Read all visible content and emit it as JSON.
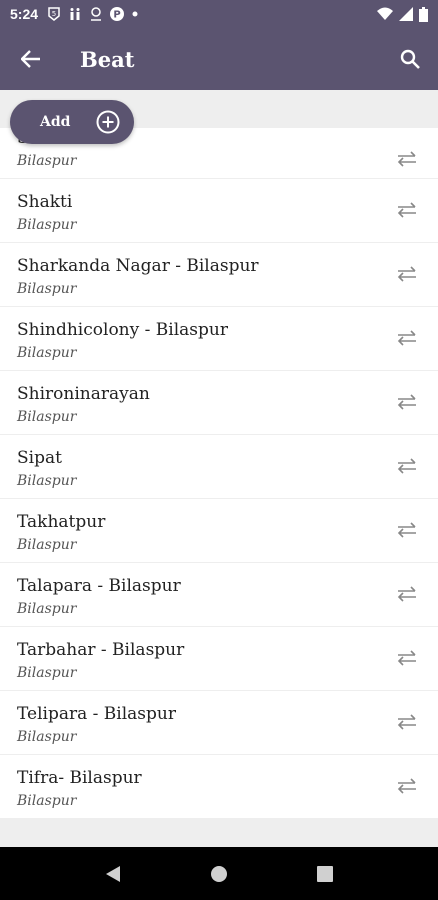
{
  "status": {
    "time": "5:24"
  },
  "appbar": {
    "title": "Beat"
  },
  "add_button": {
    "label": "Add"
  },
  "items": [
    {
      "name": "Sarkanda",
      "sub": "Bilaspur"
    },
    {
      "name": "Shakti",
      "sub": "Bilaspur"
    },
    {
      "name": "Sharkanda Nagar - Bilaspur",
      "sub": "Bilaspur"
    },
    {
      "name": "Shindhicolony - Bilaspur",
      "sub": "Bilaspur"
    },
    {
      "name": "Shironinarayan",
      "sub": "Bilaspur"
    },
    {
      "name": "Sipat",
      "sub": "Bilaspur"
    },
    {
      "name": "Takhatpur",
      "sub": "Bilaspur"
    },
    {
      "name": "Talapara - Bilaspur",
      "sub": "Bilaspur"
    },
    {
      "name": "Tarbahar - Bilaspur",
      "sub": "Bilaspur"
    },
    {
      "name": "Telipara - Bilaspur",
      "sub": "Bilaspur"
    },
    {
      "name": "Tifra- Bilaspur",
      "sub": "Bilaspur"
    }
  ],
  "colors": {
    "primary": "#5b5470",
    "background": "#eeeeee"
  }
}
